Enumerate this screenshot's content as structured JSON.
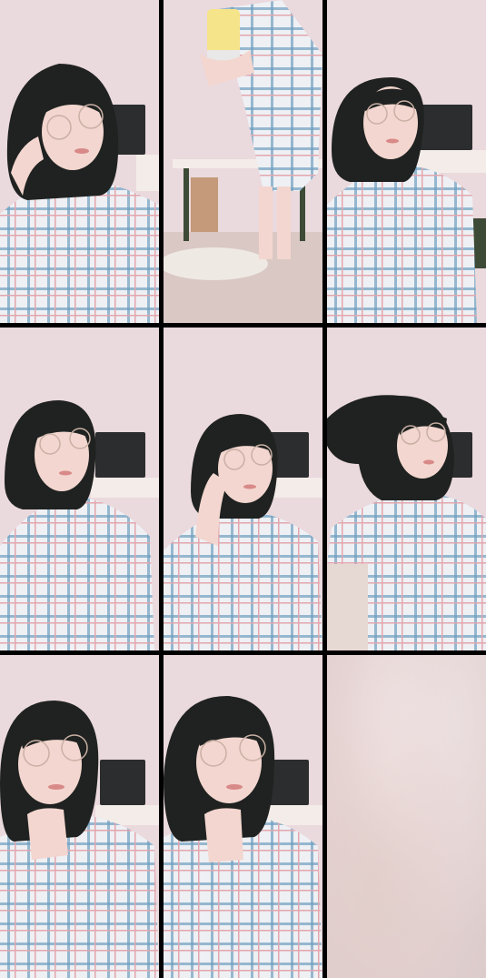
{
  "photo_grid": {
    "columns": 3,
    "rows": 3,
    "photos": [
      {
        "scene": "hand-on-cheek-glasses",
        "has_monitor": true
      },
      {
        "scene": "spilling-can-standing",
        "has_monitor": false
      },
      {
        "scene": "looking-up-glasses",
        "has_monitor": true
      },
      {
        "scene": "seated-facing-forward",
        "has_monitor": true
      },
      {
        "scene": "hand-near-face",
        "has_monitor": true
      },
      {
        "scene": "hair-flip",
        "has_monitor": true
      },
      {
        "scene": "chin-on-hand-left",
        "has_monitor": true
      },
      {
        "scene": "chin-on-hand-right",
        "has_monitor": true
      },
      {
        "scene": "blurred-placeholder",
        "has_monitor": false
      }
    ]
  },
  "colors": {
    "background_wall": "#ead9dd",
    "separator": "#000000",
    "hair": "#1f2220",
    "skin": "#f3d6cf",
    "shirt_base": "#eef0f4",
    "plaid_blue": "#6f9fc0",
    "plaid_pink": "#e3a6ad",
    "monitor": "#2b2d2e"
  }
}
